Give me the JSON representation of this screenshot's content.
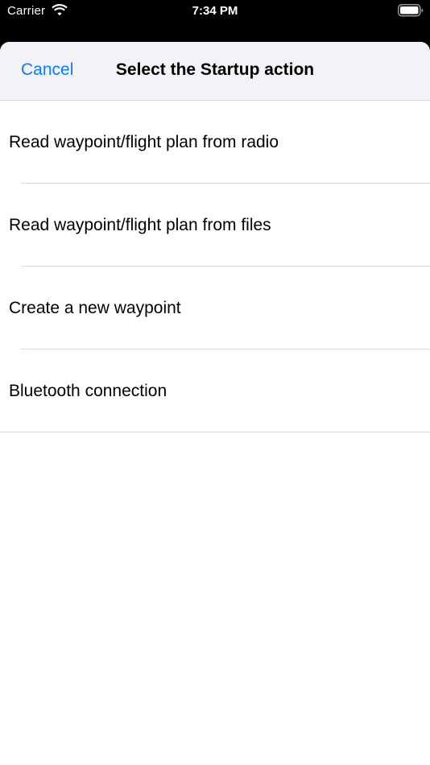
{
  "status_bar": {
    "carrier": "Carrier",
    "time": "7:34 PM",
    "wifi_icon": "wifi-icon",
    "battery_icon": "battery-icon"
  },
  "nav": {
    "cancel_label": "Cancel",
    "title": "Select the Startup action"
  },
  "actions": [
    {
      "label": "Read waypoint/flight plan from radio"
    },
    {
      "label": "Read waypoint/flight plan from files"
    },
    {
      "label": "Create a new waypoint"
    },
    {
      "label": "Bluetooth connection"
    }
  ],
  "colors": {
    "accent": "#0a7aff",
    "nav_background": "#f2f2f7",
    "status_background": "#000000"
  }
}
